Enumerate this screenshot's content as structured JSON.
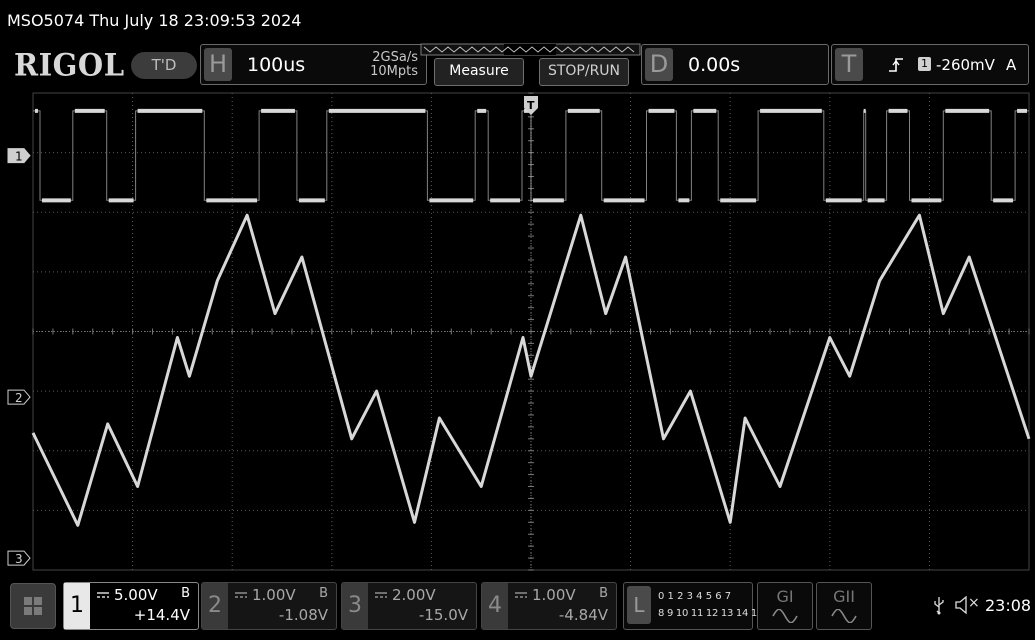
{
  "header": {
    "title": "MSO5074  Thu July 18 23:09:53 2024",
    "brand": "RIGOL",
    "mode_badge": "T'D"
  },
  "horizontal": {
    "tag": "H",
    "timebase": "100us",
    "sample_rate": "2GSa/s",
    "memory_depth": "10Mpts"
  },
  "buttons": {
    "measure": "Measure",
    "stop_run": "STOP/RUN"
  },
  "delay": {
    "tag": "D",
    "value": "0.00s"
  },
  "trigger": {
    "tag": "T",
    "source": "1",
    "level": "-260mV",
    "mode": "A",
    "marker": "T"
  },
  "channel_markers": [
    "1",
    "2",
    "3"
  ],
  "channels": [
    {
      "num": "1",
      "scale": "5.00V",
      "bw": "B",
      "offset": "+14.4V",
      "active": true
    },
    {
      "num": "2",
      "scale": "1.00V",
      "bw": "B",
      "offset": "-1.08V",
      "active": false
    },
    {
      "num": "3",
      "scale": "2.00V",
      "bw": "",
      "offset": "-15.0V",
      "active": false
    },
    {
      "num": "4",
      "scale": "1.00V",
      "bw": "B",
      "offset": "-4.84V",
      "active": false
    }
  ],
  "logic": {
    "tag": "L",
    "row1": "0 1 2 3  4 5 6 7",
    "row2": "8 9 10 11 12 13 14 15"
  },
  "gen1": "GI",
  "gen2": "GII",
  "status": {
    "clock": "23:08",
    "mute_symbol": "×"
  },
  "colors": {
    "trace": "#d8d8d8",
    "grid": "#5a5a5a",
    "background": "#000000"
  },
  "chart_data": {
    "type": "line",
    "title": "",
    "xlabel": "",
    "ylabel": "",
    "grid": true,
    "divisions": {
      "x": 10,
      "y": 8
    },
    "xlim": [
      -500,
      500
    ],
    "x_unit": "us",
    "series": [
      {
        "channel": "1",
        "kind": "digital-square",
        "levels_div": [
          2.2,
          3.7
        ],
        "edges_us": [
          -493,
          -460,
          -426,
          -397,
          -328,
          -273,
          -235,
          -205,
          -104,
          -56,
          -43,
          -9,
          0,
          35,
          71,
          116,
          146,
          161,
          188,
          228,
          294,
          334,
          336,
          357,
          380,
          414,
          462,
          486
        ],
        "start_level": "high"
      },
      {
        "channel": "2",
        "kind": "analog",
        "x": [
          -500,
          -455,
          -425,
          -395,
          -355,
          -343,
          -315,
          -285,
          -257,
          -230,
          -180,
          -155,
          -117,
          -92,
          -50,
          -8,
          0,
          50,
          75,
          95,
          133,
          160,
          200,
          215,
          250,
          300,
          320,
          350,
          390,
          414,
          440,
          500
        ],
        "y": [
          -1.7,
          -3.25,
          -1.55,
          -2.6,
          -0.1,
          -0.75,
          0.85,
          1.95,
          0.3,
          1.25,
          -1.8,
          -1.0,
          -3.2,
          -1.45,
          -2.6,
          -0.1,
          -0.75,
          1.95,
          0.3,
          1.25,
          -1.8,
          -1.0,
          -3.2,
          -1.45,
          -2.6,
          -0.1,
          -0.75,
          0.85,
          1.95,
          0.3,
          1.25,
          -1.8
        ]
      }
    ]
  }
}
